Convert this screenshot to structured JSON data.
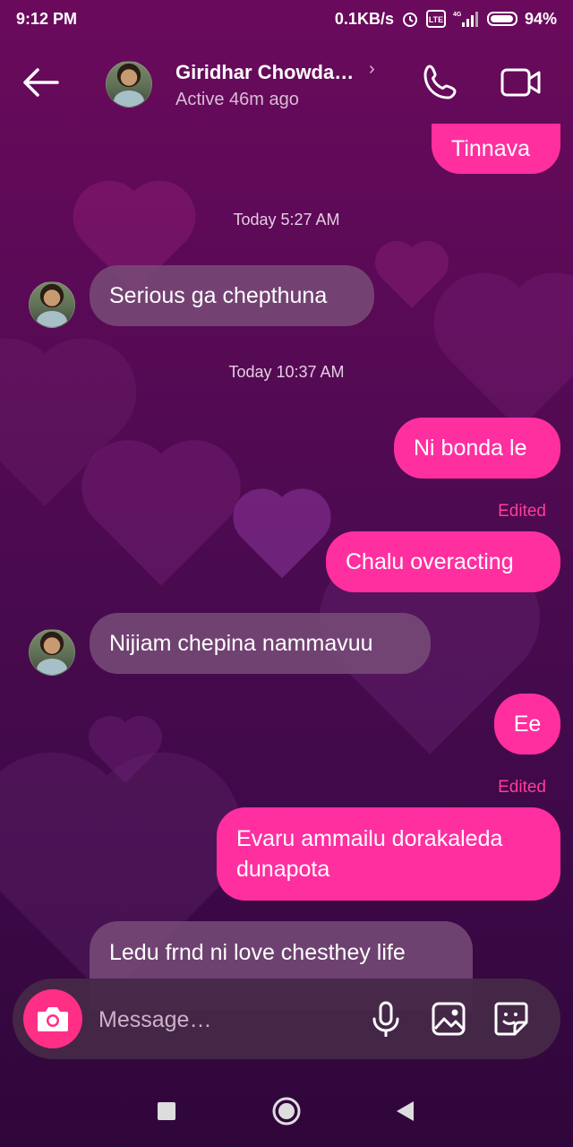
{
  "status_bar": {
    "time": "9:12 PM",
    "network_speed": "0.1KB/s",
    "network_type": "4G",
    "volte": "Vo LTE",
    "battery": "94%"
  },
  "header": {
    "contact_name": "Giridhar Chowda…",
    "chevron": "›",
    "status": "Active 46m ago"
  },
  "icons": {
    "back": "back-arrow-icon",
    "call": "phone-icon",
    "video": "video-camera-icon",
    "camera": "camera-icon",
    "mic": "microphone-icon",
    "gallery": "image-icon",
    "sticker": "sticker-icon"
  },
  "conversation": {
    "msg0": "Tinnava",
    "ts1": "Today 5:27 AM",
    "msg1": "Serious ga chepthuna",
    "ts2": "Today 10:37 AM",
    "msg2": "Ni bonda le",
    "edited1": "Edited",
    "msg3": "Chalu overacting",
    "msg4": "Nijiam chepina nammavuu",
    "msg5": "Ee",
    "edited2": "Edited",
    "msg6_line1": "Evaru ammailu dorakaleda",
    "msg6_line2": "dunapota",
    "msg7_line1": "Ledu frnd ni love chesthey life"
  },
  "input": {
    "placeholder": "Message…"
  },
  "colors": {
    "outgoing_bubble": "#ff2fa0",
    "incoming_bubble": "#784c78",
    "accent": "#ff2f86",
    "edited": "#ff3d97"
  }
}
